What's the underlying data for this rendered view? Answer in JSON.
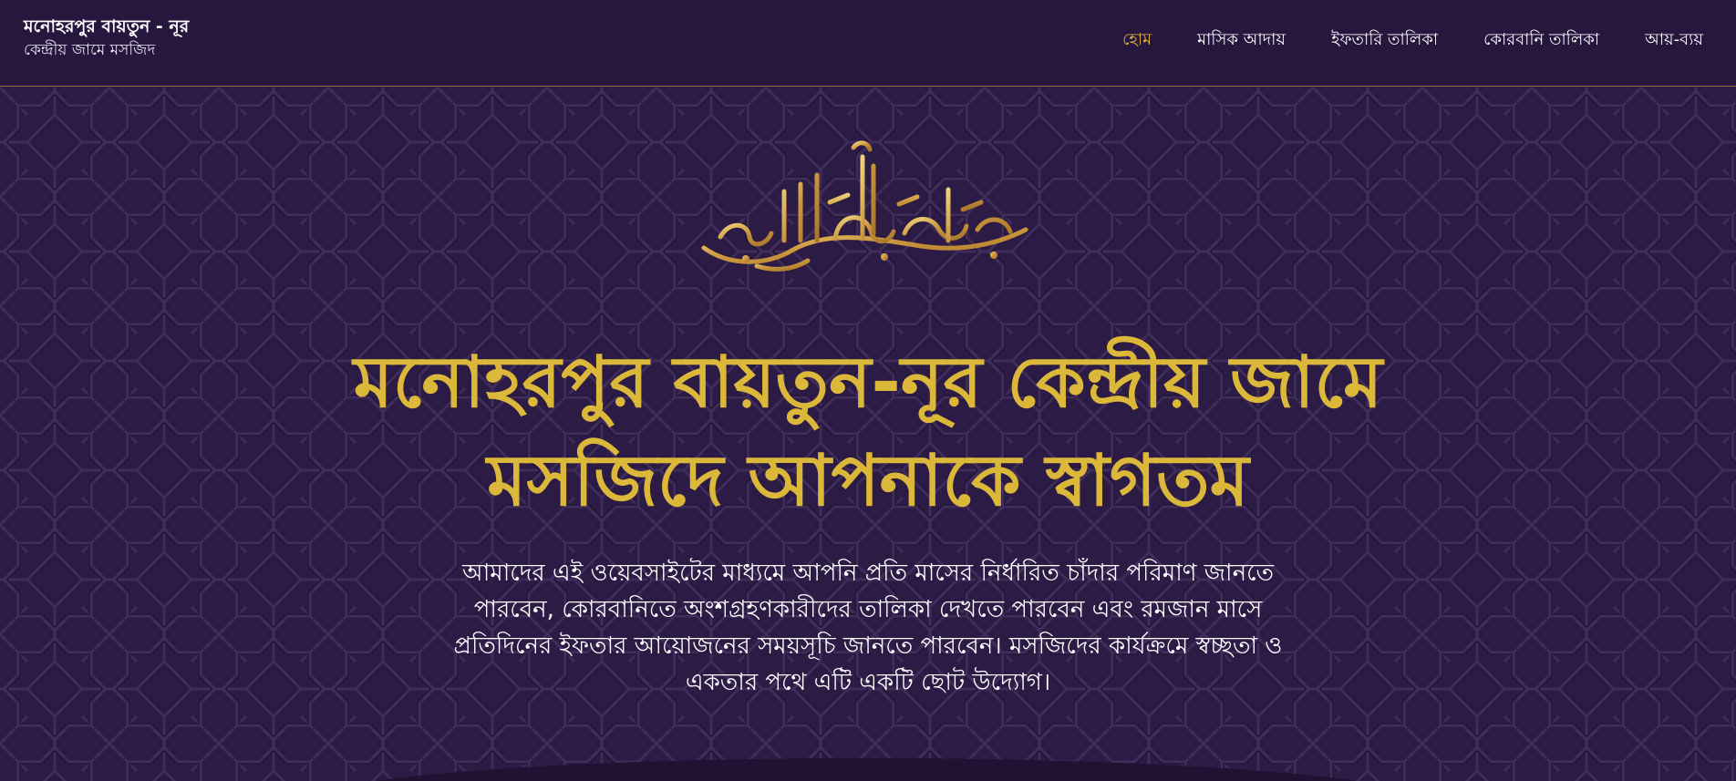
{
  "brand": {
    "title": "মনোহরপুর বায়তুন - নূর",
    "subtitle": "কেন্দ্রীয় জামে মসজিদ"
  },
  "nav": {
    "items": [
      {
        "label": "হোম",
        "active": true
      },
      {
        "label": "মাসিক আদায়",
        "active": false
      },
      {
        "label": "ইফতারি তালিকা",
        "active": false
      },
      {
        "label": "কোরবানি তালিকা",
        "active": false
      },
      {
        "label": "আয়-ব্যয়",
        "active": false
      }
    ]
  },
  "hero": {
    "calligraphy_text": "بسم الله الرحمن الرحيم",
    "title": "মনোহরপুর বায়তুন-নূর কেন্দ্রীয় জামে মসজিদে আপনাকে স্বাগতম",
    "description": "আমাদের এই ওয়েবসাইটের মাধ্যমে আপনি প্রতি মাসের নির্ধারিত চাঁদার পরিমাণ জানতে পারবেন, কোরবানিতে অংশগ্রহণকারীদের তালিকা দেখতে পারবেন এবং রমজান মাসে প্রতিদিনের ইফতার আয়োজনের সময়সূচি জানতে পারবেন। মসজিদের কার্যক্রমে স্বচ্ছতা ও একতার পথে এটি একটি ছোট উদ্যোগ।"
  },
  "colors": {
    "nav_background": "#27173f",
    "hero_background": "#2c1b44",
    "accent_gold": "#dcb83a",
    "active_link": "#e1b33c",
    "text_white": "#ffffff"
  }
}
